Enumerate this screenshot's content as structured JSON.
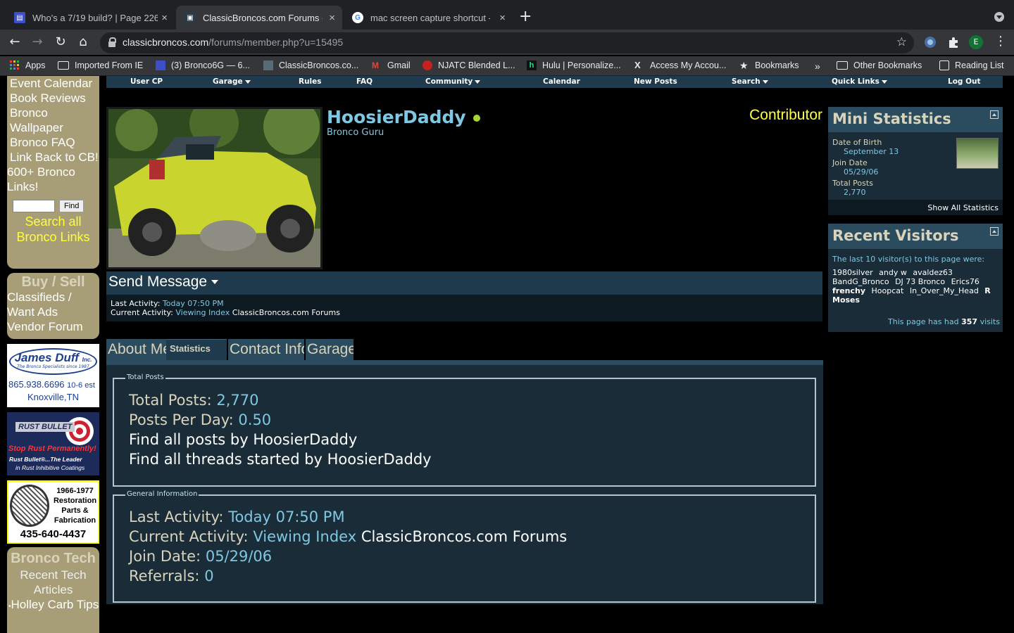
{
  "browser": {
    "tabs": [
      {
        "title": "Who's a 7/19 build? | Page 226",
        "close": "×"
      },
      {
        "title": "ClassicBroncos.com Forums - View Profile",
        "close": "×"
      },
      {
        "title": "mac screen capture shortcut - Google Search",
        "close": "×"
      }
    ],
    "new_tab": "+",
    "url_host": "classicbroncos.com",
    "url_path": "/forums/member.php?u=15495",
    "profile_initial": "E",
    "bookmarks": [
      "Apps",
      "Imported From IE",
      "(3) Bronco6G — 6...",
      "ClassicBroncos.co...",
      "Gmail",
      "NJATC Blended L...",
      "Hulu | Personalize...",
      "Access My Accou...",
      "Bookmarks"
    ],
    "overflow": "»",
    "other_bookmarks": "Other Bookmarks",
    "reading_list": "Reading List"
  },
  "sidebar": {
    "links": [
      "Event Calendar",
      "Book Reviews",
      "Bronco Wallpaper",
      "Bronco FAQ",
      "Link Back to CB!",
      "600+ Bronco Links!"
    ],
    "find_button": "Find",
    "search_all": "Search all Bronco Links",
    "buy_sell": {
      "head": "Buy / Sell",
      "links": [
        "Classifieds / Want Ads",
        "Vendor Forum"
      ]
    },
    "ads": {
      "james_duff": {
        "name": "James Duff",
        "inc": "Inc.",
        "tagline": "The Bronco Specialists since 1987",
        "phone": "865.938.6696",
        "ext": "10-6 est",
        "city": "Knoxville,TN"
      },
      "rust_bullet": {
        "name": "RUST BULLET",
        "slogan": "Stop Rust Permanently!",
        "line1": "Rust Bullet®...The Leader",
        "line2": "in Rust Inhibitive Coatings"
      },
      "restoration": {
        "years": "1966-1977",
        "l1": "Restoration",
        "l2": "Parts &",
        "l3": "Fabrication",
        "phone": "435-640-4437"
      }
    },
    "tech": {
      "head": "Bronco Tech",
      "sub": "Recent Tech Articles",
      "item": "Holley Carb Tips"
    }
  },
  "navbar": {
    "items": [
      {
        "label": "User CP"
      },
      {
        "label": "Garage"
      },
      {
        "label": "Rules"
      },
      {
        "label": "FAQ"
      },
      {
        "label": "Community"
      },
      {
        "label": "Calendar"
      },
      {
        "label": "New Posts"
      },
      {
        "label": "Search"
      },
      {
        "label": "Quick Links"
      },
      {
        "label": "Log Out"
      }
    ]
  },
  "profile": {
    "username": "HoosierDaddy",
    "usertitle": "Bronco Guru",
    "rank": "Contributor",
    "send_message": "Send Message",
    "last_activity_label": "Last Activity:",
    "last_activity_value": "Today 07:50 PM",
    "current_activity_label": "Current Activity:",
    "current_activity_link": "Viewing Index",
    "current_activity_site": "ClassicBroncos.com Forums"
  },
  "tabs": [
    "About Me",
    "Statistics",
    "Contact Info",
    "Garage"
  ],
  "total_posts_section": {
    "legend": "Total Posts",
    "total_posts_label": "Total Posts:",
    "total_posts_value": "2,770",
    "ppd_label": "Posts Per Day:",
    "ppd_value": "0.50",
    "find_posts": "Find all posts by HoosierDaddy",
    "find_threads": "Find all threads started by HoosierDaddy"
  },
  "general_section": {
    "legend": "General Information",
    "last_activity_label": "Last Activity:",
    "last_activity_value": "Today 07:50 PM",
    "current_activity_label": "Current Activity:",
    "current_activity_link": "Viewing Index",
    "current_activity_site": "ClassicBroncos.com Forums",
    "join_label": "Join Date:",
    "join_value": "05/29/06",
    "referrals_label": "Referrals:",
    "referrals_value": "0"
  },
  "mini_stats": {
    "title": "Mini Statistics",
    "dob_label": "Date of Birth",
    "dob_value": "September 13",
    "join_label": "Join Date",
    "join_value": "05/29/06",
    "posts_label": "Total Posts",
    "posts_value": "2,770",
    "show_all": "Show All Statistics"
  },
  "recent_visitors": {
    "title": "Recent Visitors",
    "intro": "The last 10 visitor(s) to this page were:",
    "names": [
      "1980silver",
      "andy w",
      "avaldez63",
      "BandG_Bronco",
      "DJ 73 Bronco",
      "Erics76",
      "frenchy",
      "Hoopcat",
      "In_Over_My_Head",
      "R Moses"
    ],
    "count_prefix": "This page has had",
    "count": "357",
    "count_suffix": "visits"
  },
  "colors": {
    "accent_blue": "#7ec8e3",
    "header_bg": "#1e3a4c",
    "sidebar_tan": "#a79e78",
    "rank_yellow": "#ffff44"
  }
}
